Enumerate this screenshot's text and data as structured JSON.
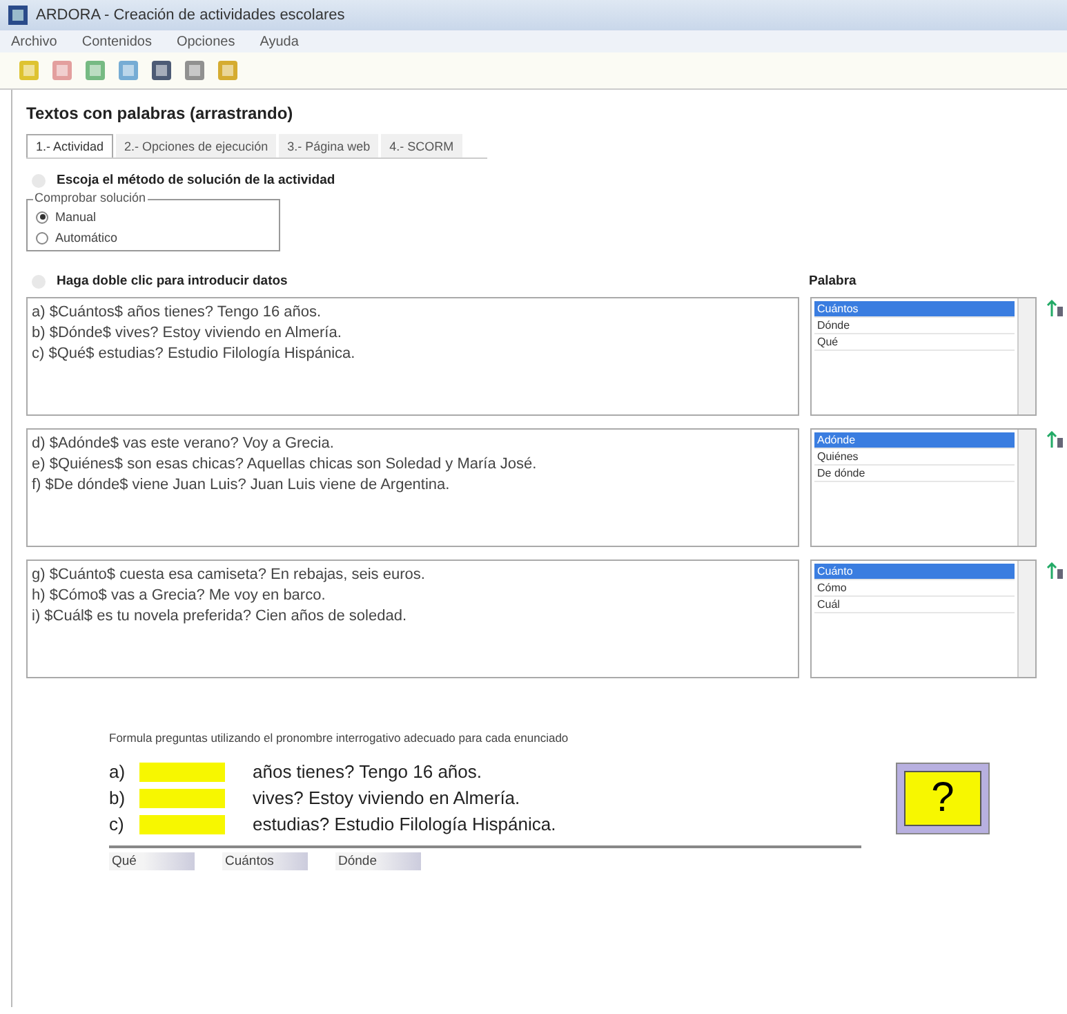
{
  "window": {
    "title": "ARDORA - Creación de actividades escolares"
  },
  "menu": [
    "Archivo",
    "Contenidos",
    "Opciones",
    "Ayuda"
  ],
  "activity_title": "Textos con palabras (arrastrando)",
  "tabs": [
    {
      "label": "1.- Actividad",
      "selected": true
    },
    {
      "label": "2.- Opciones de ejecución",
      "selected": false
    },
    {
      "label": "3.- Página web",
      "selected": false
    },
    {
      "label": "4.- SCORM",
      "selected": false
    }
  ],
  "method_heading": "Escoja el método de solución de la actividad",
  "solution_group": {
    "legend": "Comprobar solución",
    "options": [
      {
        "label": "Manual",
        "selected": true
      },
      {
        "label": "Automático",
        "selected": false
      }
    ]
  },
  "data_heading": "Haga doble clic para introducir datos",
  "word_column_label": "Palabra",
  "groups": [
    {
      "lines": [
        "a) $Cuántos$ años tienes? Tengo 16 años.",
        "b) $Dónde$ vives? Estoy viviendo en Almería.",
        "c) $Qué$ estudias? Estudio Filología Hispánica."
      ],
      "words": [
        {
          "label": "Cuántos",
          "selected": true
        },
        {
          "label": "Dónde",
          "selected": false
        },
        {
          "label": "Qué",
          "selected": false
        }
      ]
    },
    {
      "lines": [
        "d) $Adónde$ vas este verano? Voy a Grecia.",
        "e) $Quiénes$ son esas chicas? Aquellas chicas son Soledad y María José.",
        "f) $De dónde$ viene Juan Luis? Juan Luis viene de Argentina."
      ],
      "words": [
        {
          "label": "Adónde",
          "selected": true
        },
        {
          "label": "Quiénes",
          "selected": false
        },
        {
          "label": "De dónde",
          "selected": false
        }
      ]
    },
    {
      "lines": [
        "g) $Cuánto$ cuesta esa camiseta? En rebajas, seis euros.",
        "h) $Cómo$ vas a Grecia? Me voy en barco.",
        "i) $Cuál$ es tu novela preferida? Cien años de soledad."
      ],
      "words": [
        {
          "label": "Cuánto",
          "selected": true
        },
        {
          "label": "Cómo",
          "selected": false
        },
        {
          "label": "Cuál",
          "selected": false
        }
      ]
    }
  ],
  "preview": {
    "instruction": "Formula preguntas utilizando el pronombre interrogativo adecuado para cada enunciado",
    "sentences": [
      {
        "letter": "a)",
        "text": "años tienes? Tengo 16 años."
      },
      {
        "letter": "b)",
        "text": "vives? Estoy viviendo en Almería."
      },
      {
        "letter": "c)",
        "text": "estudias? Estudio Filología Hispánica."
      }
    ],
    "help_button": "?",
    "words": [
      "Qué",
      "Cuántos",
      "Dónde"
    ]
  }
}
